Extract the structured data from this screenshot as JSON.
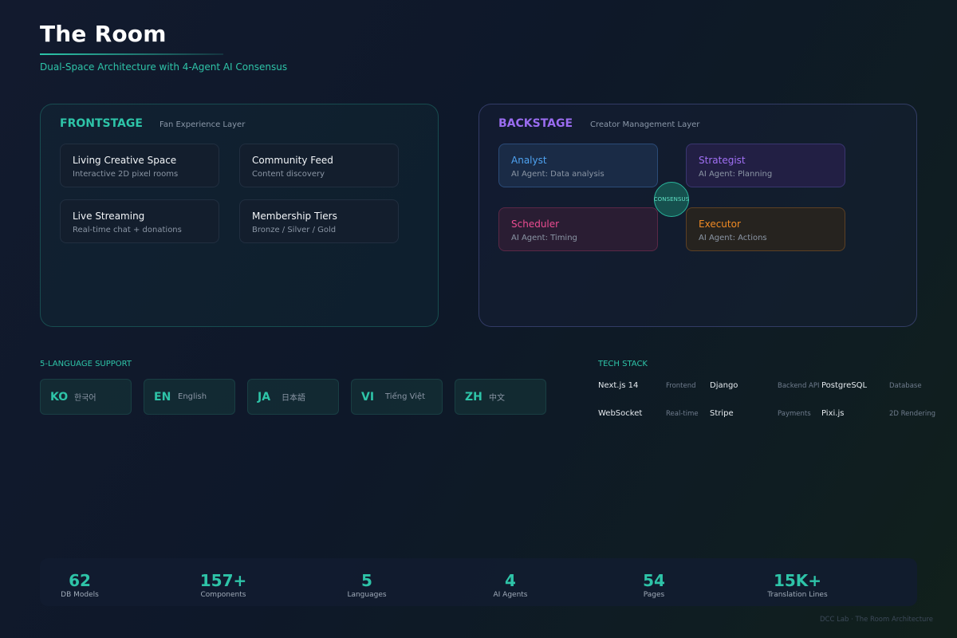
{
  "header": {
    "title": "The Room",
    "subtitle": "Dual-Space Architecture with 4-Agent AI Consensus"
  },
  "frontstage": {
    "title": "FRONTSTAGE",
    "subtitle": "Fan Experience Layer",
    "cards": [
      {
        "title": "Living Creative Space",
        "desc": "Interactive 2D pixel rooms"
      },
      {
        "title": "Community Feed",
        "desc": "Content discovery"
      },
      {
        "title": "Live Streaming",
        "desc": "Real-time chat + donations"
      },
      {
        "title": "Membership Tiers",
        "desc": "Bronze / Silver / Gold"
      }
    ]
  },
  "backstage": {
    "title": "BACKSTAGE",
    "subtitle": "Creator Management Layer",
    "agents": [
      {
        "name": "Analyst",
        "desc": "AI Agent: Data analysis",
        "color": "#4ea2f0"
      },
      {
        "name": "Strategist",
        "desc": "AI Agent: Planning",
        "color": "#a170f5"
      },
      {
        "name": "Scheduler",
        "desc": "AI Agent: Timing",
        "color": "#ec4c92"
      },
      {
        "name": "Executor",
        "desc": "AI Agent: Actions",
        "color": "#f08a24"
      }
    ],
    "consensus": "CONSENSUS"
  },
  "languages": {
    "label": "5-LANGUAGE SUPPORT",
    "items": [
      {
        "code": "KO",
        "name": "한국어"
      },
      {
        "code": "EN",
        "name": "English"
      },
      {
        "code": "JA",
        "name": "日本語"
      },
      {
        "code": "VI",
        "name": "Tiếng Việt"
      },
      {
        "code": "ZH",
        "name": "中文"
      }
    ]
  },
  "tech": {
    "label": "TECH STACK",
    "items": [
      {
        "name": "Next.js 14",
        "role": "Frontend"
      },
      {
        "name": "Django",
        "role": "Backend API"
      },
      {
        "name": "PostgreSQL",
        "role": "Database"
      },
      {
        "name": "WebSocket",
        "role": "Real-time"
      },
      {
        "name": "Stripe",
        "role": "Payments"
      },
      {
        "name": "Pixi.js",
        "role": "2D Rendering"
      }
    ]
  },
  "stats": [
    {
      "value": "62",
      "label": "DB Models"
    },
    {
      "value": "157+",
      "label": "Components"
    },
    {
      "value": "5",
      "label": "Languages"
    },
    {
      "value": "4",
      "label": "AI Agents"
    },
    {
      "value": "54",
      "label": "Pages"
    },
    {
      "value": "15K+",
      "label": "Translation Lines"
    }
  ],
  "footer": "DCC Lab · The Room Architecture",
  "colors": {
    "accent": "#2ec4a8",
    "backstage": "#9a6cf0"
  }
}
